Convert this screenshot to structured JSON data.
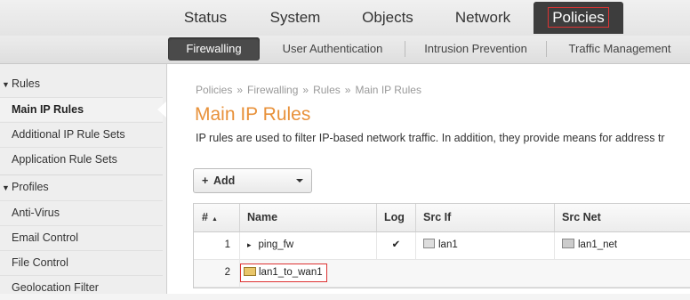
{
  "topnav": {
    "items": [
      "Status",
      "System",
      "Objects",
      "Network",
      "Policies"
    ],
    "active": "Policies"
  },
  "subnav": {
    "tabs": [
      "Firewalling",
      "User Authentication",
      "Intrusion Prevention",
      "Traffic Management"
    ],
    "active": "Firewalling"
  },
  "sidebar": {
    "groups": [
      {
        "label": "Rules",
        "items": [
          "Main IP Rules",
          "Additional IP Rule Sets",
          "Application Rule Sets"
        ]
      },
      {
        "label": "Profiles",
        "items": [
          "Anti-Virus",
          "Email Control",
          "File Control",
          "Geolocation Filter"
        ]
      }
    ],
    "active_item": "Main IP Rules"
  },
  "breadcrumb": [
    "Policies",
    "Firewalling",
    "Rules",
    "Main IP Rules"
  ],
  "breadcrumb_sep": "»",
  "page": {
    "title": "Main IP Rules",
    "description": "IP rules are used to filter IP-based network traffic. In addition, they provide means for address tr"
  },
  "add_button": {
    "label": "Add",
    "plus": "+"
  },
  "table": {
    "columns": [
      "#",
      "Name",
      "Log",
      "Src If",
      "Src Net"
    ],
    "rows": [
      {
        "num": "1",
        "name": "ping_fw",
        "expander": "▸",
        "log": "✔",
        "src_if": "lan1",
        "src_net": "lan1_net"
      },
      {
        "num": "2",
        "name": "lan1_to_wan1",
        "log": "",
        "src_if": "",
        "src_net": ""
      }
    ]
  },
  "colors": {
    "accent": "#e8913a",
    "nav_active_bg": "#3d3d3d",
    "highlight_border": "#dd3333"
  }
}
